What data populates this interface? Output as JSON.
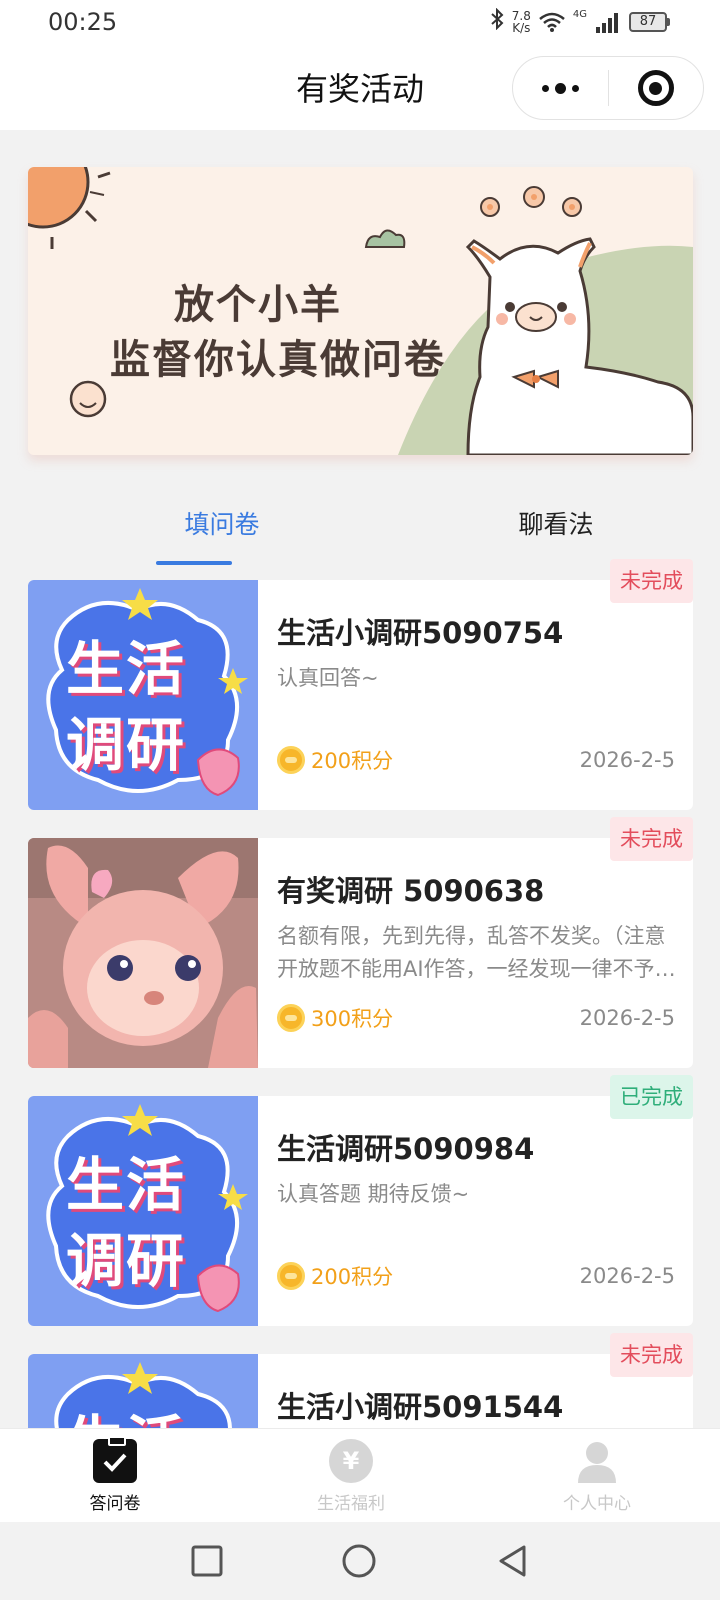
{
  "status_bar": {
    "time": "00:25",
    "speed_value": "7.8",
    "speed_unit": "K/s",
    "network": "4G",
    "battery": "87"
  },
  "header": {
    "title": "有奖活动"
  },
  "banner": {
    "line1": "放个小羊",
    "line2": "监督你认真做问卷"
  },
  "tabs": {
    "active": "填问卷",
    "other": "聊看法"
  },
  "cards": [
    {
      "title": "生活小调研5090754",
      "desc": "认真回答~",
      "points": "200积分",
      "date": "2026-2-5",
      "status": "未完成",
      "thumb_text_1": "生活",
      "thumb_text_2": "调研"
    },
    {
      "title": "有奖调研 5090638",
      "desc": "名额有限，先到先得，乱答不发奖。（注意开放题不能用AI作答，一经发现一律不予发奖）",
      "points": "300积分",
      "date": "2026-2-5",
      "status": "未完成"
    },
    {
      "title": "生活调研5090984",
      "desc": "认真答题 期待反馈~",
      "points": "200积分",
      "date": "2026-2-5",
      "status": "已完成",
      "thumb_text_1": "生活",
      "thumb_text_2": "调研"
    },
    {
      "title": "生活小调研5091544",
      "status": "未完成",
      "thumb_text_1": "生活"
    }
  ],
  "bottom_nav": {
    "item1": "答问卷",
    "item2": "生活福利",
    "item3": "个人中心"
  },
  "colors": {
    "accent": "#3a7be0",
    "points": "#f2a019",
    "pending": "#e34d5c",
    "done": "#2fae7a"
  }
}
